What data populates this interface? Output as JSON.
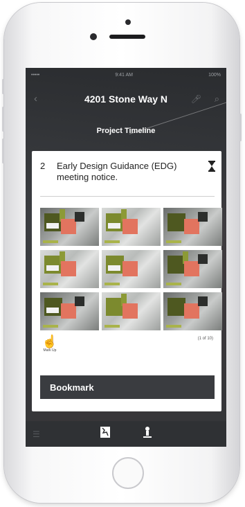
{
  "status_bar": {
    "carrier": "•••••",
    "time": "9:41 AM",
    "battery": "100%"
  },
  "nav": {
    "title": "4201 Stone Way N",
    "back_icon": "chevron-left-icon",
    "mic_icon": "mic-icon",
    "search_icon": "search-icon"
  },
  "section": {
    "label": "Project Timeline"
  },
  "card": {
    "number": "2",
    "title": "Early Design Guidance (EDG) meeting notice.",
    "page_count": "(1 of 10)",
    "markup_label": "Mark Up",
    "bookmark_label": "Bookmark"
  },
  "tabbar": {
    "items": [
      "menu-icon",
      "map-icon",
      "person-icon"
    ]
  },
  "colors": {
    "accent_dark": "#3a3c40",
    "thumb_salmon": "#e2745f",
    "thumb_olive": "#7c8a2e"
  }
}
